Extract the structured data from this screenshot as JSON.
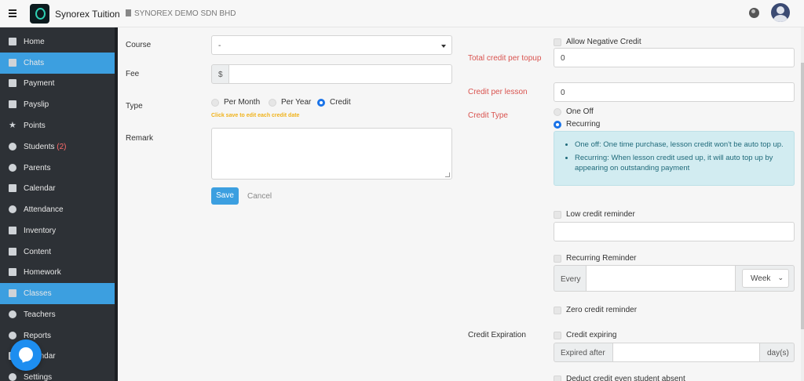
{
  "header": {
    "app_name": "Synorex Tuition",
    "company": "SYNOREX DEMO SDN BHD",
    "icons": [
      "hamburger-icon",
      "app-logo",
      "building-icon",
      "globe-icon",
      "user-avatar"
    ]
  },
  "sidebar": {
    "items": [
      {
        "label": "Home",
        "icon": "home-icon",
        "active": false
      },
      {
        "label": "Chats",
        "icon": "file-icon",
        "active": true
      },
      {
        "label": "Payment",
        "icon": "file-icon",
        "active": false
      },
      {
        "label": "Payslip",
        "icon": "file-icon",
        "active": false
      },
      {
        "label": "Points",
        "icon": "star-icon",
        "active": false
      },
      {
        "label": "Students",
        "count": "(2)",
        "icon": "users-icon",
        "active": false
      },
      {
        "label": "Parents",
        "icon": "user-circle-icon",
        "active": false
      },
      {
        "label": "Calendar",
        "icon": "calendar-icon",
        "active": false
      },
      {
        "label": "Attendance",
        "icon": "dashboard-icon",
        "active": false
      },
      {
        "label": "Inventory",
        "icon": "chart-icon",
        "active": false
      },
      {
        "label": "Content",
        "icon": "bullhorn-icon",
        "active": false
      },
      {
        "label": "Homework",
        "icon": "book-icon",
        "active": false
      },
      {
        "label": "Classes",
        "icon": "school-icon",
        "active": true
      },
      {
        "label": "Teachers",
        "icon": "teacher-icon",
        "active": false
      },
      {
        "label": "Reports",
        "icon": "pie-chart-icon",
        "active": false
      },
      {
        "label": "Calendar",
        "icon": "calendar-icon",
        "active": false
      },
      {
        "label": "Settings",
        "icon": "gears-icon",
        "active": false
      }
    ]
  },
  "form": {
    "course_label": "Course",
    "course_value": "-",
    "fee_label": "Fee",
    "fee_prefix": "$",
    "fee_value": "",
    "type_label": "Type",
    "type_options": [
      "Per Month",
      "Per Year",
      "Credit"
    ],
    "type_selected": "Credit",
    "type_hint": "Click save to edit each credit date",
    "remark_label": "Remark",
    "remark_value": "",
    "save_label": "Save",
    "cancel_label": "Cancel"
  },
  "credit": {
    "allow_negative_label": "Allow Negative Credit",
    "total_per_topup_label": "Total credit per topup",
    "total_per_topup_value": "0",
    "per_lesson_label": "Credit per lesson",
    "per_lesson_value": "0",
    "credit_type_label": "Credit Type",
    "credit_type_options": [
      "One Off",
      "Recurring"
    ],
    "credit_type_selected": "Recurring",
    "info": [
      "One off: One time purchase, lesson credit won't be auto top up.",
      "Recurring: When lesson credit used up, it will auto top up by appearing on outstanding payment"
    ],
    "low_reminder_label": "Low credit reminder",
    "low_reminder_value": "",
    "recurring_reminder_label": "Recurring Reminder",
    "every_label": "Every",
    "every_value": "",
    "period_value": "Week",
    "zero_reminder_label": "Zero credit reminder",
    "expiration_label": "Credit Expiration",
    "credit_expiring_label": "Credit expiring",
    "expired_after_label": "Expired after",
    "expired_after_value": "",
    "days_suffix": "day(s)",
    "deduct_label": "Deduct credit even student absent"
  },
  "colors": {
    "sidebar_bg": "#2d3136",
    "accent": "#3c9fe0",
    "required_label": "#d9534f",
    "hint": "#f0b21a",
    "info_bg": "#d2ecf1"
  }
}
